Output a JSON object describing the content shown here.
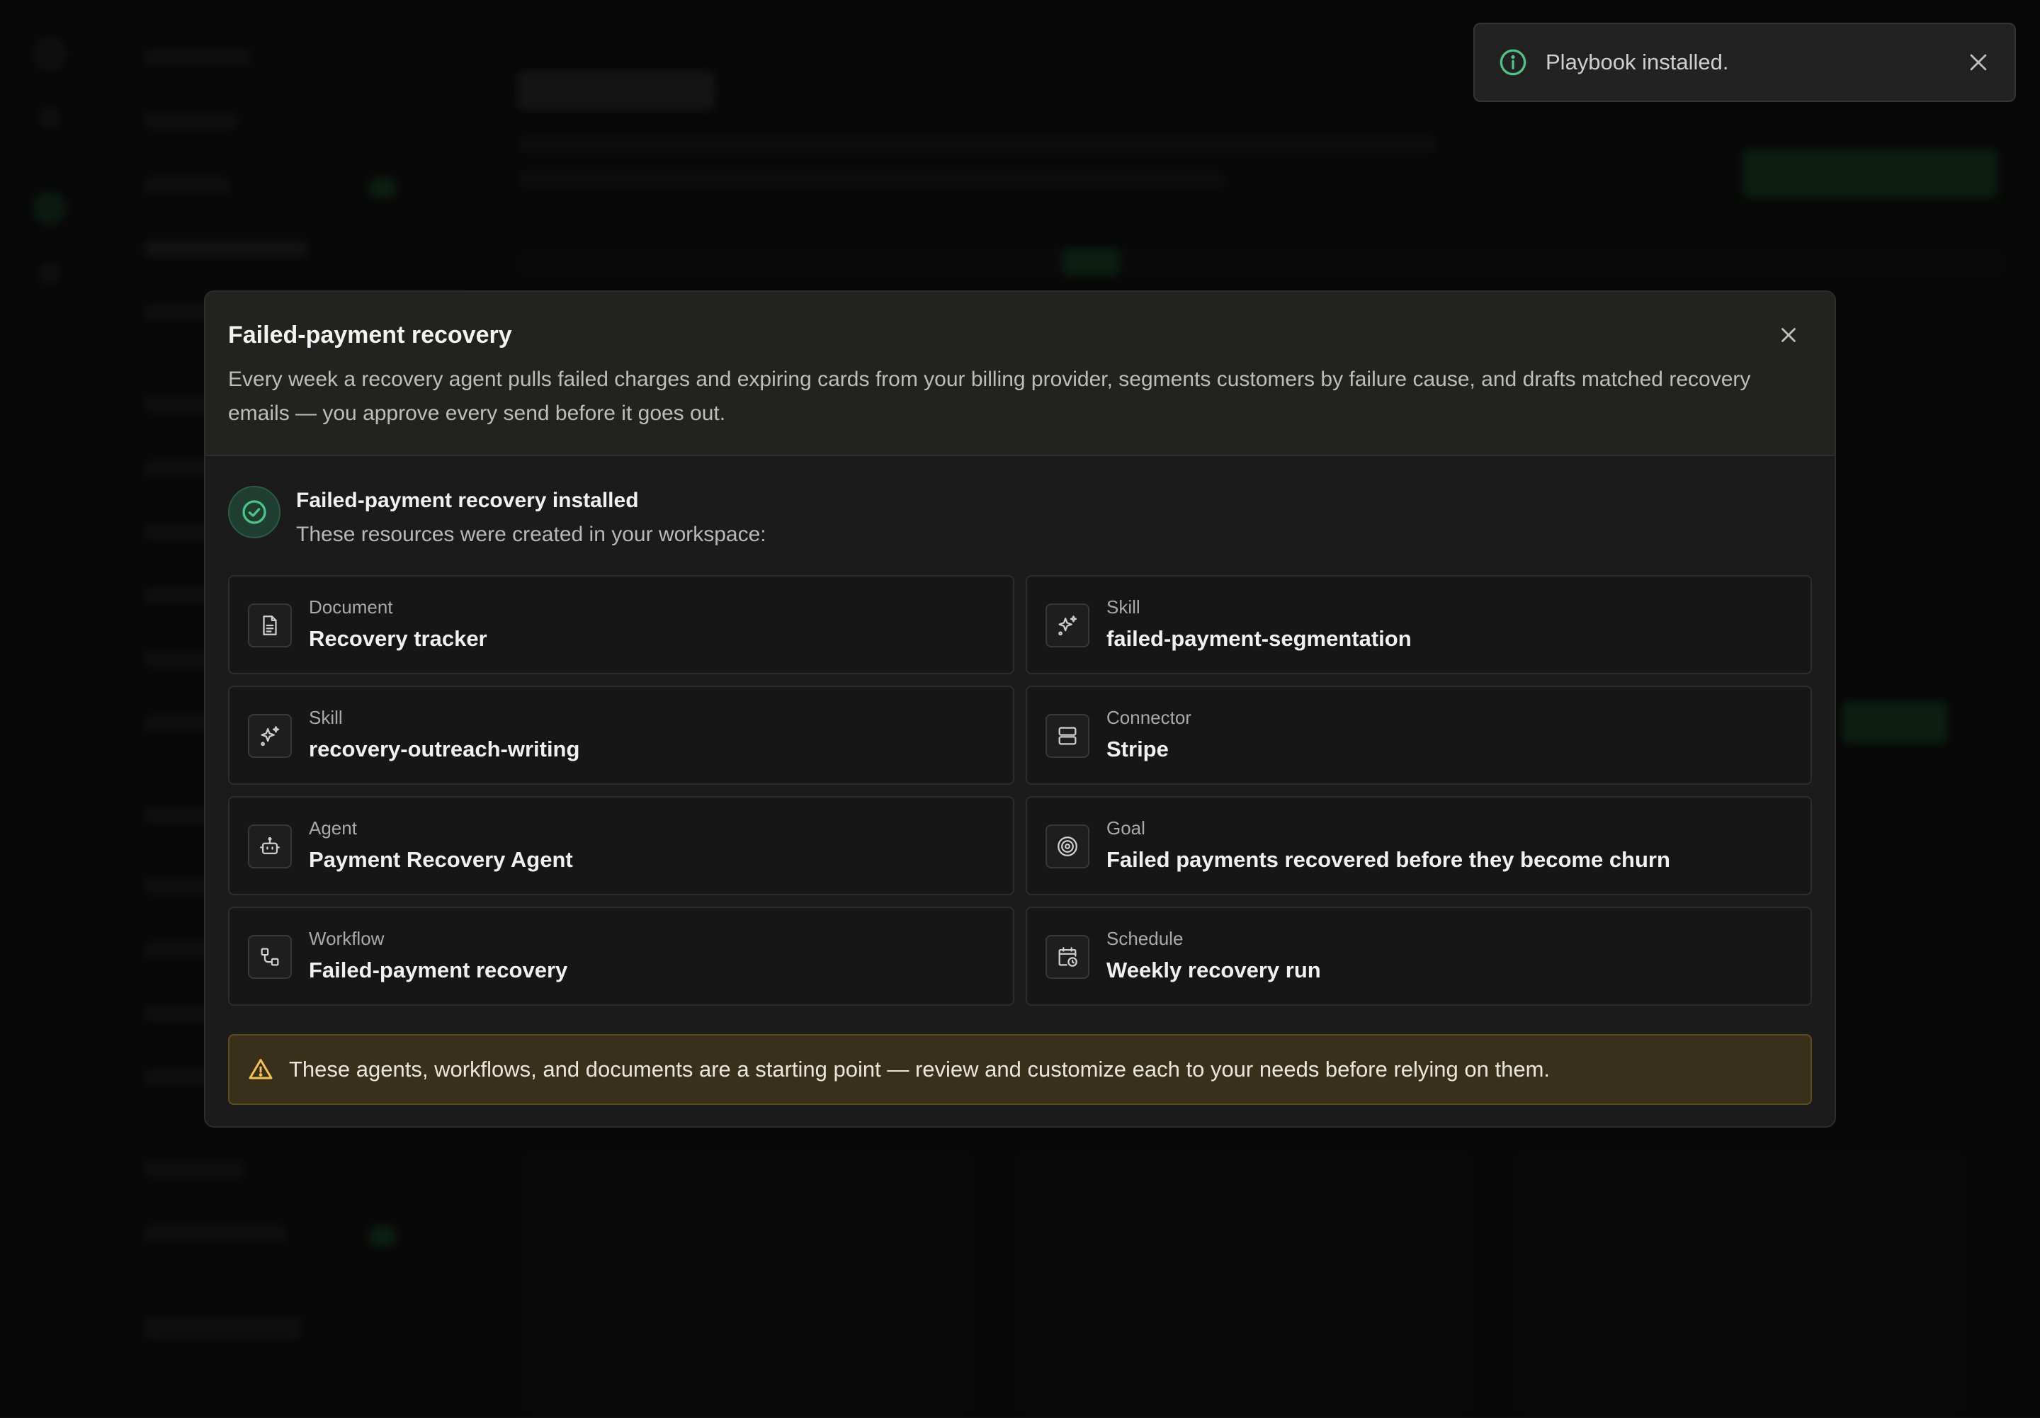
{
  "toast": {
    "message": "Playbook installed.",
    "icon": "info-icon",
    "icon_color": "#4cc38a"
  },
  "modal": {
    "title": "Failed-payment recovery",
    "description": "Every week a recovery agent pulls failed charges and expiring cards from your billing provider, segments customers by failure cause, and drafts matched recovery emails — you approve every send before it goes out.",
    "installed_title": "Failed-payment recovery installed",
    "installed_subtitle": "These resources were created in your workspace:",
    "resources": [
      {
        "type": "Document",
        "name": "Recovery tracker",
        "icon": "document-icon"
      },
      {
        "type": "Skill",
        "name": "failed-payment-segmentation",
        "icon": "sparkles-icon"
      },
      {
        "type": "Skill",
        "name": "recovery-outreach-writing",
        "icon": "sparkles-icon"
      },
      {
        "type": "Connector",
        "name": "Stripe",
        "icon": "server-icon"
      },
      {
        "type": "Agent",
        "name": "Payment Recovery Agent",
        "icon": "bot-icon"
      },
      {
        "type": "Goal",
        "name": "Failed payments recovered before they become churn",
        "icon": "target-icon"
      },
      {
        "type": "Workflow",
        "name": "Failed-payment recovery",
        "icon": "workflow-icon"
      },
      {
        "type": "Schedule",
        "name": "Weekly recovery run",
        "icon": "calendar-clock-icon"
      }
    ],
    "warning": "These agents, workflows, and documents are a starting point — review and customize each to your needs before relying on them."
  },
  "colors": {
    "accent_green": "#4cc38a",
    "warning_bg": "#38301b",
    "warning_icon": "#f0c44c"
  }
}
